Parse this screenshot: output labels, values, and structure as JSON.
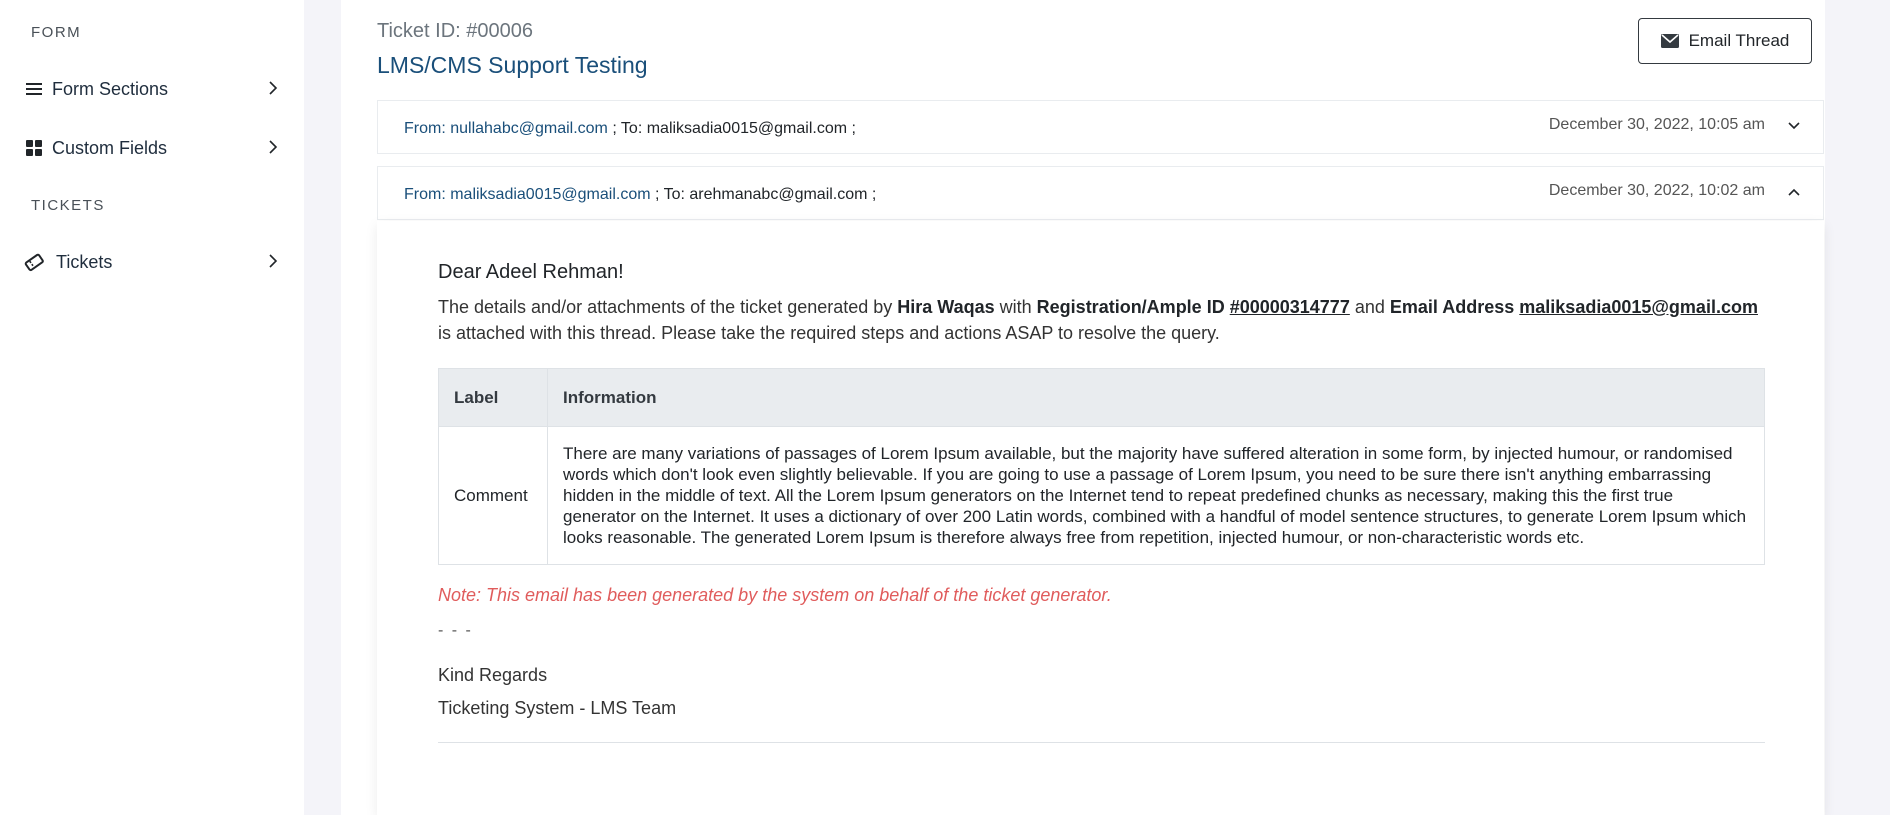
{
  "sidebar": {
    "form_section_label": "FORM",
    "tickets_section_label": "TICKETS",
    "items": [
      {
        "label": "Form Sections",
        "icon": "list-icon"
      },
      {
        "label": "Custom Fields",
        "icon": "grid-icon"
      },
      {
        "label": "Tickets",
        "icon": "ticket-icon"
      }
    ]
  },
  "ticket": {
    "id_label": "Ticket ID: #00006",
    "title": "LMS/CMS Support Testing",
    "email_thread_button": "Email Thread"
  },
  "threads": [
    {
      "from": "From: nullahabc@gmail.com",
      "to": " ; To: maliksadia0015@gmail.com ;",
      "date": "December 30, 2022, 10:05 am",
      "expanded": false
    },
    {
      "from": "From: maliksadia0015@gmail.com",
      "to": " ; To: arehmanabc@gmail.com ;",
      "date": "December 30, 2022, 10:02 am",
      "expanded": true
    }
  ],
  "email": {
    "greeting": "Dear Adeel Rehman!",
    "intro_1": "The details and/or attachments of the ticket generated by ",
    "generator_name": "Hira Waqas",
    "intro_2": " with ",
    "reg_label": "Registration/Ample ID ",
    "reg_id": "#00000314777",
    "intro_3": " and ",
    "email_label": "Email Address ",
    "email_address": "maliksadia0015@gmail.com",
    "intro_4": " is attached with this thread. Please take the required steps and actions ASAP to resolve the query.",
    "table": {
      "headers": [
        "Label",
        "Information"
      ],
      "rows": [
        {
          "label": "Comment",
          "information": "There are many variations of passages of Lorem Ipsum available, but the majority have suffered alteration in some form, by injected humour, or randomised words which don't look even slightly believable. If you are going to use a passage of Lorem Ipsum, you need to be sure there isn't anything embarrassing hidden in the middle of text. All the Lorem Ipsum generators on the Internet tend to repeat predefined chunks as necessary, making this the first true generator on the Internet. It uses a dictionary of over 200 Latin words, combined with a handful of model sentence structures, to generate Lorem Ipsum which looks reasonable. The generated Lorem Ipsum is therefore always free from repetition, injected humour, or non-characteristic words etc."
        }
      ]
    },
    "note": "Note: This email has been generated by the system on behalf of the ticket generator.",
    "separator": "- - -",
    "regards": "Kind Regards",
    "signature": "Ticketing System - LMS Team"
  },
  "colors": {
    "accent": "#1a4f7a",
    "note": "#e05c5c",
    "table_header_bg": "#e9ecef",
    "page_bg": "#f4f4f9"
  }
}
